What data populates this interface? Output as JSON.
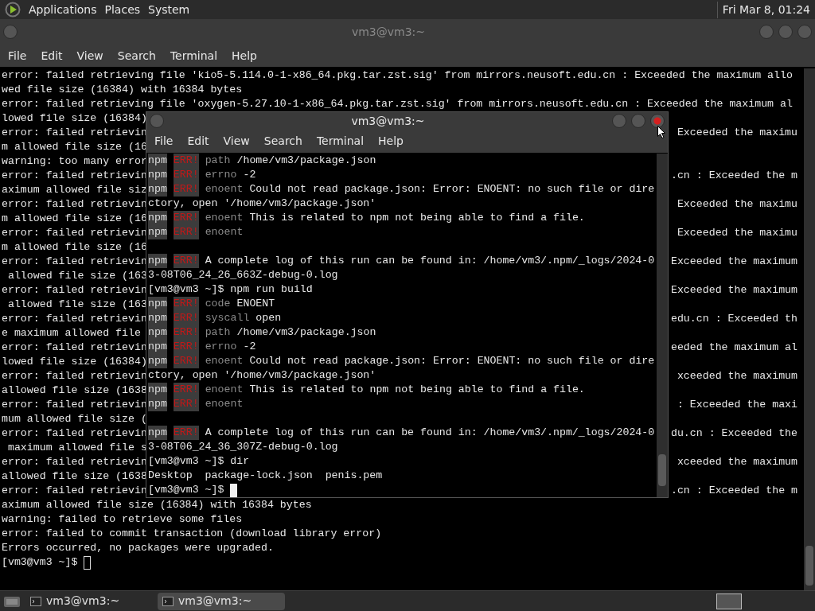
{
  "top_panel": {
    "menus": [
      "Applications",
      "Places",
      "System"
    ],
    "clock": "Fri Mar 8, 01:24"
  },
  "back_window": {
    "title": "vm3@vm3:~",
    "menu": [
      "File",
      "Edit",
      "View",
      "Search",
      "Terminal",
      "Help"
    ],
    "lines": [
      {
        "kind": "full",
        "text": "error: failed retrieving file 'kio5-5.114.0-1-x86_64.pkg.tar.zst.sig' from mirrors.neusoft.edu.cn : Exceeded the maximum allo"
      },
      {
        "kind": "full",
        "text": "wed file size (16384) with 16384 bytes"
      },
      {
        "kind": "full",
        "text": "error: failed retrieving file 'oxygen-5.27.10-1-x86_64.pkg.tar.zst.sig' from mirrors.neusoft.edu.cn : Exceeded the maximum al"
      },
      {
        "kind": "split",
        "left": "lowed file size (16384)"
      },
      {
        "kind": "split",
        "left": "error: failed retrievin",
        "right": "Exceeded the maximu"
      },
      {
        "kind": "split",
        "left": "m allowed file size (16"
      },
      {
        "kind": "split",
        "left": "warning: too many error"
      },
      {
        "kind": "split",
        "left": "error: failed retrievin",
        "right": ".cn : Exceeded the m"
      },
      {
        "kind": "split",
        "left": "aximum allowed file siz"
      },
      {
        "kind": "split",
        "left": "error: failed retrievin",
        "right": "Exceeded the maximu"
      },
      {
        "kind": "split",
        "left": "m allowed file size (16"
      },
      {
        "kind": "split",
        "left": "error: failed retrievin",
        "right": "Exceeded the maximu"
      },
      {
        "kind": "split",
        "left": "m allowed file size (16"
      },
      {
        "kind": "split",
        "left": "error: failed retrievin",
        "right": "Exceeded the maximum"
      },
      {
        "kind": "split",
        "left": " allowed file size (163"
      },
      {
        "kind": "split",
        "left": "error: failed retrievin",
        "right": "Exceeded the maximum"
      },
      {
        "kind": "split",
        "left": " allowed file size (163"
      },
      {
        "kind": "split",
        "left": "error: failed retrievin",
        "right": "edu.cn : Exceeded th"
      },
      {
        "kind": "split",
        "left": "e maximum allowed file"
      },
      {
        "kind": "split",
        "left": "error: failed retrievin",
        "right": "eeded the maximum al"
      },
      {
        "kind": "split",
        "left": "lowed file size (16384)"
      },
      {
        "kind": "split",
        "left": "error: failed retrievin",
        "right": "xceeded the maximum"
      },
      {
        "kind": "split",
        "left": "allowed file size (1638"
      },
      {
        "kind": "split",
        "left": "error: failed retrievin",
        "right": ": Exceeded the maxi"
      },
      {
        "kind": "split",
        "left": "mum allowed file size ("
      },
      {
        "kind": "split",
        "left": "error: failed retrievin",
        "right": "du.cn : Exceeded the"
      },
      {
        "kind": "split",
        "left": " maximum allowed file s"
      },
      {
        "kind": "split",
        "left": "error: failed retrievin",
        "right": "xceeded the maximum"
      },
      {
        "kind": "split",
        "left": "allowed file size (1638"
      },
      {
        "kind": "split",
        "left": "error: failed retrievin",
        "right": ".cn : Exceeded the m"
      },
      {
        "kind": "full",
        "text": "aximum allowed file size (16384) with 16384 bytes"
      },
      {
        "kind": "full",
        "text": "warning: failed to retrieve some files"
      },
      {
        "kind": "full",
        "text": "error: failed to commit transaction (download library error)"
      },
      {
        "kind": "full",
        "text": "Errors occurred, no packages were upgraded."
      },
      {
        "kind": "prompt",
        "text": "[vm3@vm3 ~]$"
      }
    ]
  },
  "front_window": {
    "title": "vm3@vm3:~",
    "menu": [
      "File",
      "Edit",
      "View",
      "Search",
      "Terminal",
      "Help"
    ],
    "lines": [
      {
        "kind": "npm",
        "prefix": "npm",
        "tag": "ERR!",
        "key": "path",
        "text": "/home/vm3/package.json"
      },
      {
        "kind": "npm",
        "prefix": "npm",
        "tag": "ERR!",
        "key": "errno",
        "text": "-2"
      },
      {
        "kind": "npm",
        "prefix": "npm",
        "tag": "ERR!",
        "key": "enoent",
        "text": "Could not read package.json: Error: ENOENT: no such file or dire"
      },
      {
        "kind": "plain",
        "text": "ctory, open '/home/vm3/package.json'"
      },
      {
        "kind": "npm",
        "prefix": "npm",
        "tag": "ERR!",
        "key": "enoent",
        "text": "This is related to npm not being able to find a file."
      },
      {
        "kind": "npm",
        "prefix": "npm",
        "tag": "ERR!",
        "key": "enoent"
      },
      {
        "kind": "blank"
      },
      {
        "kind": "npm",
        "prefix": "npm",
        "tag": "ERR!",
        "text": "A complete log of this run can be found in: /home/vm3/.npm/_logs/2024-0"
      },
      {
        "kind": "plain",
        "text": "3-08T06_24_26_663Z-debug-0.log"
      },
      {
        "kind": "plain",
        "text": "[vm3@vm3 ~]$ npm run build"
      },
      {
        "kind": "npm",
        "prefix": "npm",
        "tag": "ERR!",
        "key": "code",
        "text": "ENOENT"
      },
      {
        "kind": "npm",
        "prefix": "npm",
        "tag": "ERR!",
        "key": "syscall",
        "text": "open"
      },
      {
        "kind": "npm",
        "prefix": "npm",
        "tag": "ERR!",
        "key": "path",
        "text": "/home/vm3/package.json"
      },
      {
        "kind": "npm",
        "prefix": "npm",
        "tag": "ERR!",
        "key": "errno",
        "text": "-2"
      },
      {
        "kind": "npm",
        "prefix": "npm",
        "tag": "ERR!",
        "key": "enoent",
        "text": "Could not read package.json: Error: ENOENT: no such file or dire"
      },
      {
        "kind": "plain",
        "text": "ctory, open '/home/vm3/package.json'"
      },
      {
        "kind": "npm",
        "prefix": "npm",
        "tag": "ERR!",
        "key": "enoent",
        "text": "This is related to npm not being able to find a file."
      },
      {
        "kind": "npm",
        "prefix": "npm",
        "tag": "ERR!",
        "key": "enoent"
      },
      {
        "kind": "blank"
      },
      {
        "kind": "npm",
        "prefix": "npm",
        "tag": "ERR!",
        "text": "A complete log of this run can be found in: /home/vm3/.npm/_logs/2024-0"
      },
      {
        "kind": "plain",
        "text": "3-08T06_24_36_307Z-debug-0.log"
      },
      {
        "kind": "plain",
        "text": "[vm3@vm3 ~]$ dir"
      },
      {
        "kind": "plain",
        "text": "Desktop  package-lock.json  penis.pem"
      },
      {
        "kind": "prompt",
        "text": "[vm3@vm3 ~]$",
        "focused": true
      }
    ]
  },
  "taskbar": {
    "tasks": [
      {
        "label": "vm3@vm3:~",
        "selected": false
      },
      {
        "label": "vm3@vm3:~",
        "selected": true
      }
    ]
  }
}
